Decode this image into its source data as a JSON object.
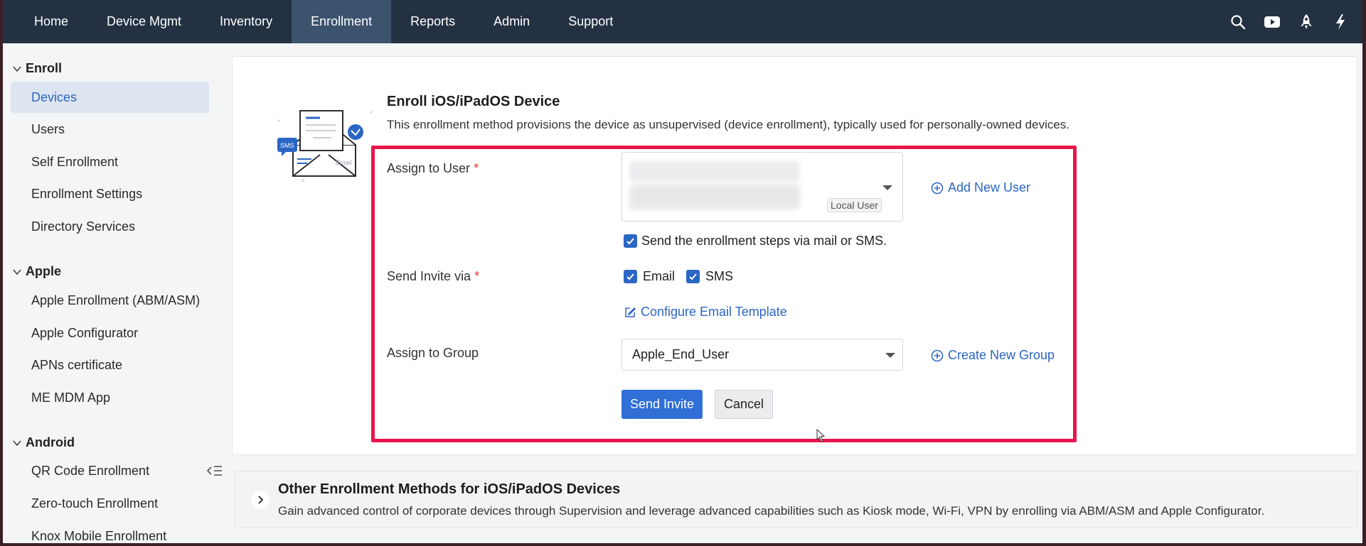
{
  "topnav": {
    "items": [
      {
        "label": "Home"
      },
      {
        "label": "Device Mgmt"
      },
      {
        "label": "Inventory"
      },
      {
        "label": "Enrollment"
      },
      {
        "label": "Reports"
      },
      {
        "label": "Admin"
      },
      {
        "label": "Support"
      }
    ],
    "active": "Enrollment",
    "icons": [
      "search-icon",
      "youtube-icon",
      "rocket-icon",
      "lightning-icon"
    ]
  },
  "sidebar": {
    "sections": [
      {
        "title": "Enroll",
        "items": [
          "Devices",
          "Users",
          "Self Enrollment",
          "Enrollment Settings",
          "Directory Services"
        ]
      },
      {
        "title": "Apple",
        "items": [
          "Apple Enrollment (ABM/ASM)",
          "Apple Configurator",
          "APNs certificate",
          "ME MDM App"
        ]
      },
      {
        "title": "Android",
        "items": [
          "QR Code Enrollment",
          "Zero-touch Enrollment",
          "Knox Mobile Enrollment"
        ]
      }
    ],
    "active_item": "Devices"
  },
  "enroll": {
    "title": "Enroll iOS/iPadOS Device",
    "description": "This enrollment method provisions the device as unsupervised (device enrollment), typically used for personally-owned devices.",
    "illustration_sms": "SMS",
    "illustration_email": "Email",
    "assign_user_label": "Assign to User",
    "required_mark": "*",
    "user_tag": "Local User",
    "add_user_link": "Add New User",
    "send_steps_label": "Send the enrollment steps via mail or SMS.",
    "send_steps_checked": true,
    "invite_label": "Send Invite via",
    "email_label": "Email",
    "email_checked": true,
    "sms_label": "SMS",
    "sms_checked": true,
    "configure_template_link": "Configure Email Template",
    "assign_group_label": "Assign to Group",
    "group_value": "Apple_End_User",
    "create_group_link": "Create New Group",
    "send_button": "Send Invite",
    "cancel_button": "Cancel"
  },
  "other_methods": {
    "title": "Other Enrollment Methods for iOS/iPadOS Devices",
    "description": "Gain advanced control of corporate devices through Supervision and leverage advanced capabilities such as Kiosk mode, Wi-Fi, VPN by enrolling via ABM/ASM and Apple Configurator."
  },
  "colors": {
    "nav_bg": "#243142",
    "nav_active": "#3c536e",
    "accent": "#2b66c4",
    "highlight_border": "#e8154d",
    "primary_button": "#2f6fd6"
  }
}
